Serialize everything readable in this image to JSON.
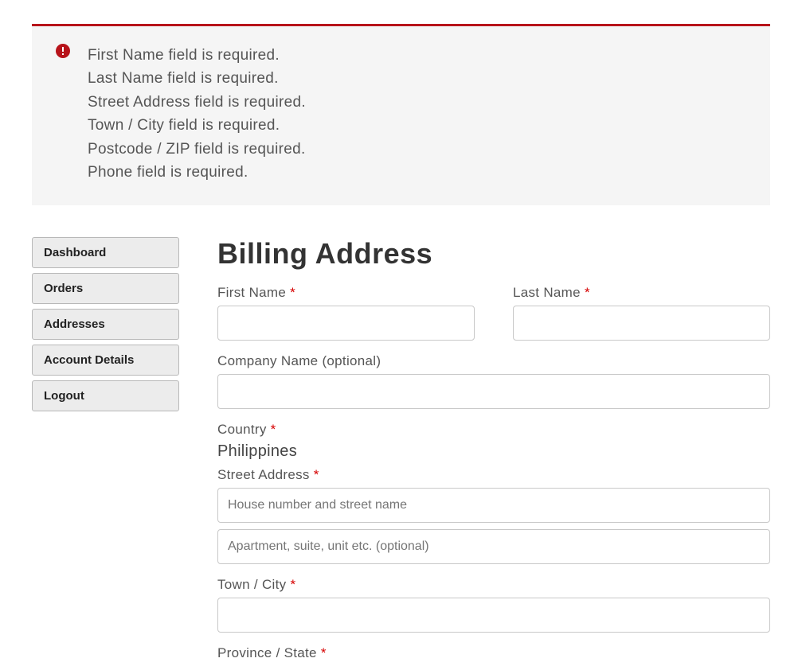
{
  "alert": {
    "messages": [
      "First Name field is required.",
      "Last Name field is required.",
      "Street Address field is required.",
      "Town / City field is required.",
      "Postcode / ZIP field is required.",
      "Phone field is required."
    ]
  },
  "sidebar": {
    "items": [
      {
        "label": "Dashboard"
      },
      {
        "label": "Orders"
      },
      {
        "label": "Addresses"
      },
      {
        "label": "Account Details"
      },
      {
        "label": "Logout"
      }
    ]
  },
  "form": {
    "title": "Billing Address",
    "first_name": {
      "label": "First Name ",
      "value": ""
    },
    "last_name": {
      "label": "Last Name ",
      "value": ""
    },
    "company": {
      "label": "Company Name (optional)",
      "value": ""
    },
    "country": {
      "label": "Country ",
      "value": "Philippines"
    },
    "street": {
      "label": "Street Address ",
      "placeholder1": "House number and street name",
      "placeholder2": "Apartment, suite, unit etc. (optional)",
      "value1": "",
      "value2": ""
    },
    "city": {
      "label": "Town / City ",
      "value": ""
    },
    "province": {
      "label": "Province / State "
    }
  },
  "required_marker": "*"
}
